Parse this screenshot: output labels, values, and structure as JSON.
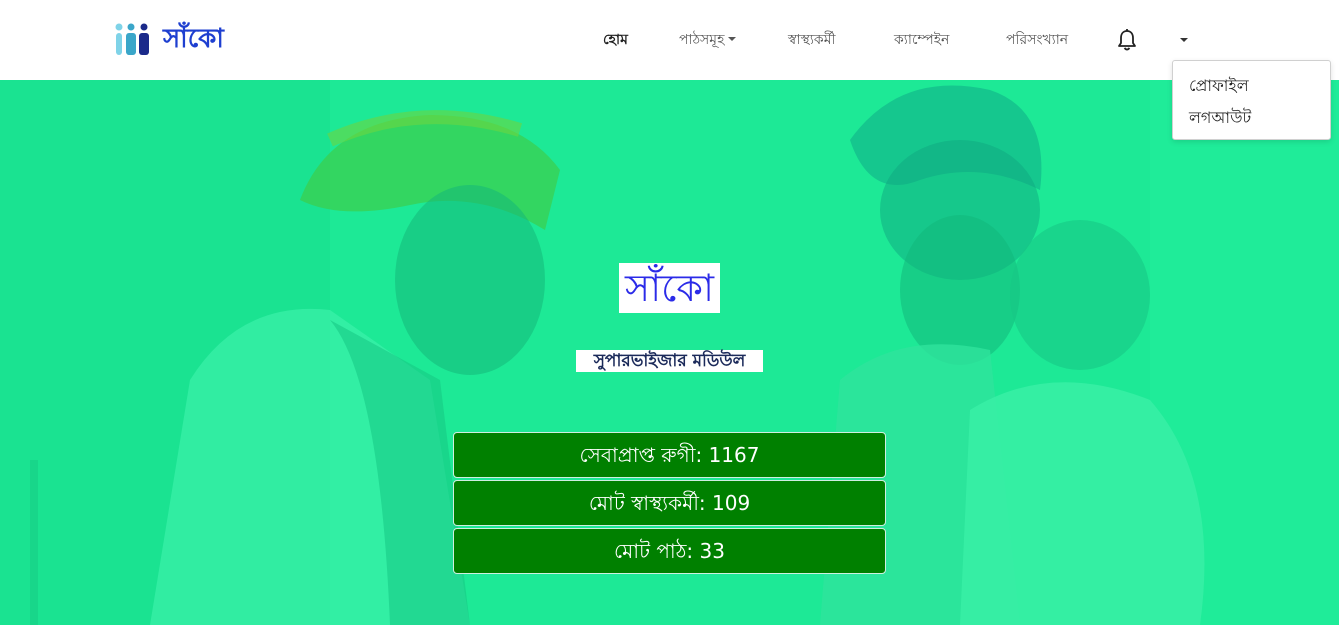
{
  "brand": {
    "name": "সাঁকো"
  },
  "nav": {
    "home": "হোম",
    "lessons": "পাঠসমূহ",
    "health_workers": "স্বাস্থ্যকর্মী",
    "campaign": "ক্যাম্পেইন",
    "statistics": "পরিসংখ্যান"
  },
  "dropdown": {
    "profile": "প্রোফাইল",
    "logout": "লগআউট"
  },
  "hero": {
    "title": "সাঁকো",
    "subtitle": "সুপারভাইজার মডিউল"
  },
  "stats": [
    {
      "text": "সেবাপ্রাপ্ত রুগী: 1167"
    },
    {
      "text": "মোট স্বাস্থ্যকর্মী: 109"
    },
    {
      "text": "মোট পাঠ: 33"
    }
  ],
  "colors": {
    "accent": "#1e3fd0",
    "hero_bg": "#1de996",
    "stat_bg": "#008000"
  }
}
